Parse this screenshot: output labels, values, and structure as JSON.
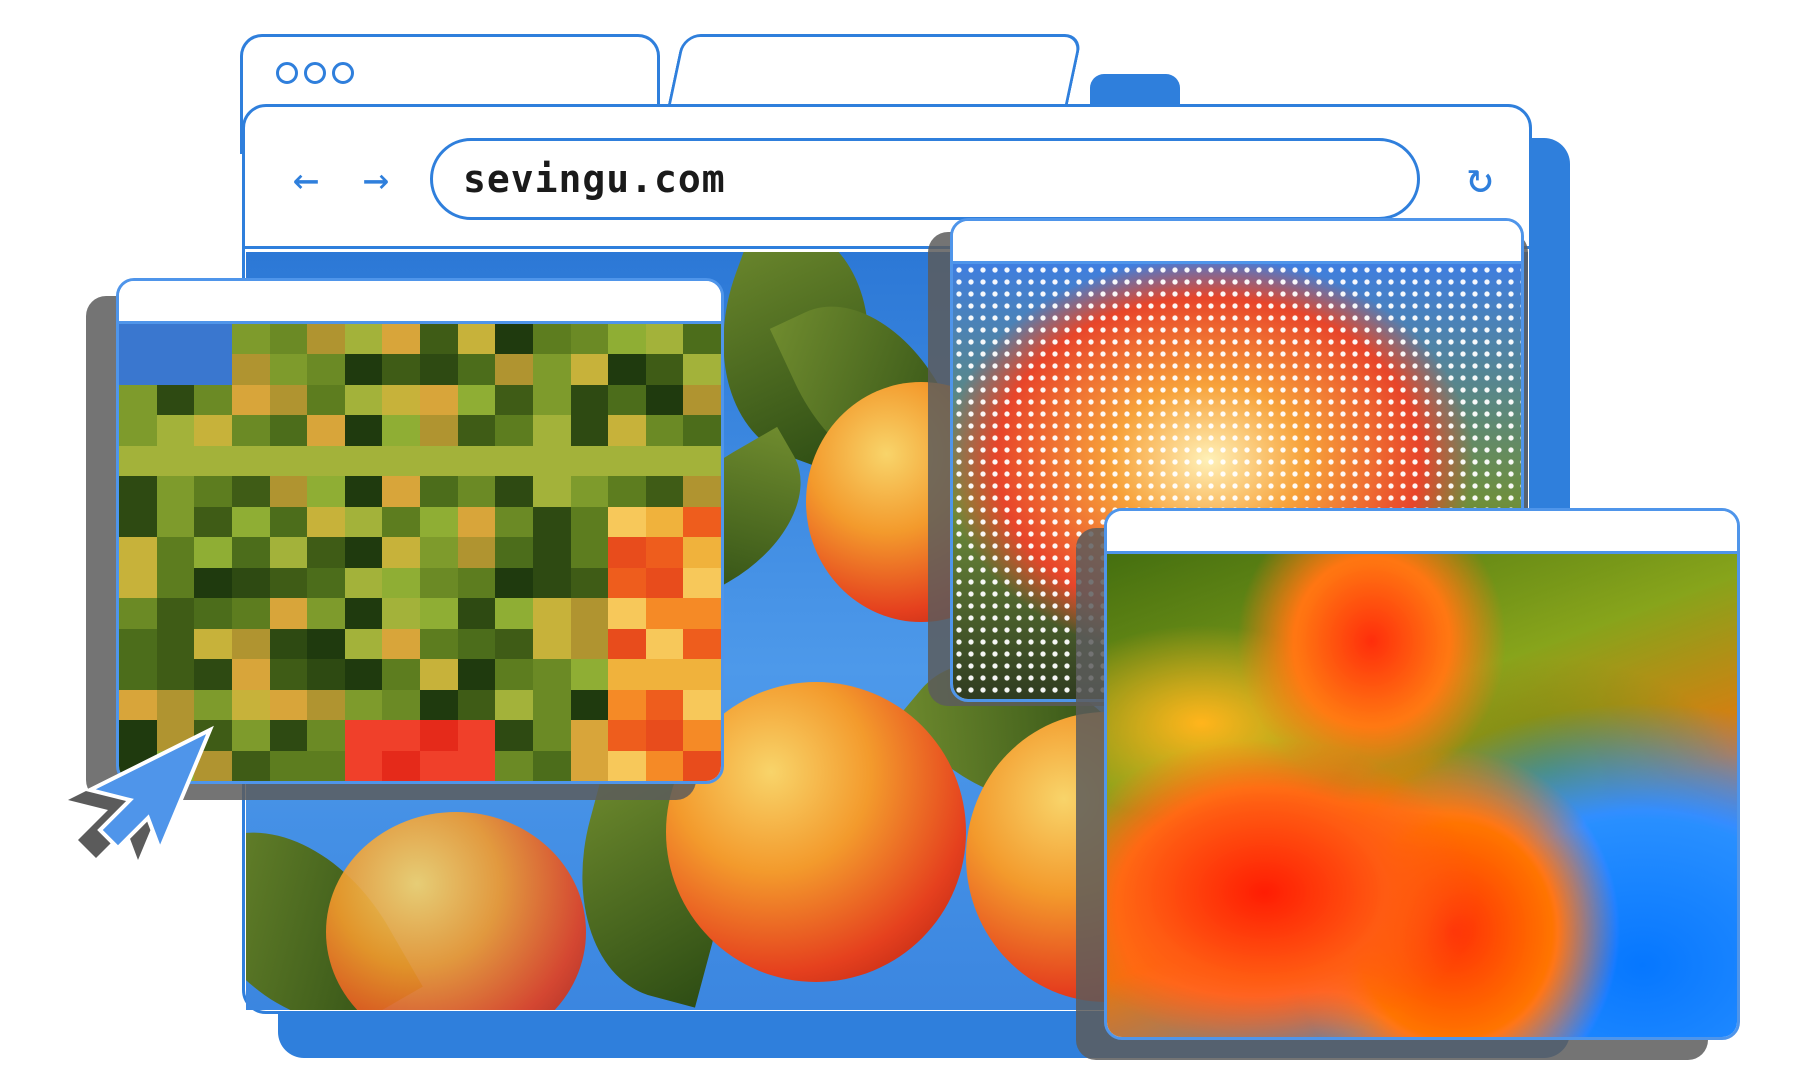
{
  "browser": {
    "url": "sevingu.com",
    "back_icon": "arrow-left-icon",
    "forward_icon": "arrow-right-icon",
    "reload_icon": "reload-icon"
  },
  "windows": {
    "pixelated": {
      "effect": "pixelate"
    },
    "halftone": {
      "effect": "halftone-dots"
    },
    "painted": {
      "effect": "oil-paint"
    }
  },
  "colors": {
    "accent": "#2f7fdc",
    "accent_light": "#4f95ea",
    "shadow": "#5c5c5c"
  },
  "cursor": {
    "icon": "cursor-arrow-icon"
  }
}
